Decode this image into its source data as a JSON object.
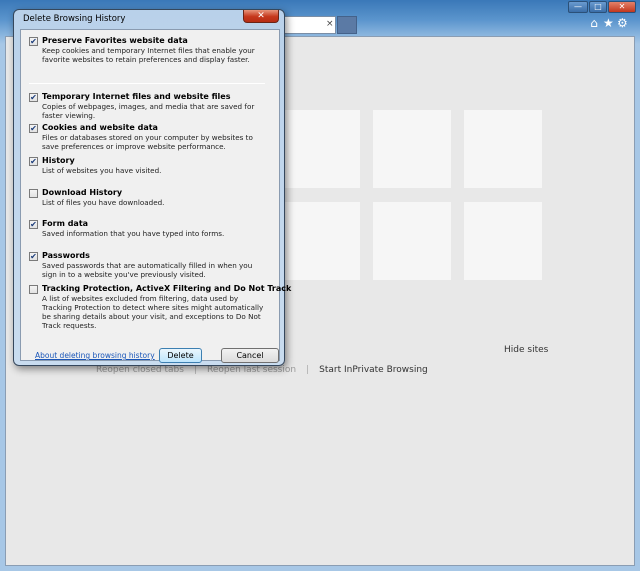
{
  "window": {
    "minimize_glyph": "—",
    "maximize_glyph": "□",
    "close_glyph": "✕"
  },
  "toolbar": {
    "address_close_glyph": "×",
    "icons": [
      "home-icon",
      "favorites-star-icon",
      "gear-icon"
    ],
    "home_glyph": "⌂",
    "star_glyph": "★",
    "gear_glyph": "⚙"
  },
  "new_tab_page": {
    "hide_sites_label": "Hide sites",
    "links": {
      "reopen_closed_tabs": "Reopen closed tabs",
      "reopen_last_session": "Reopen last session",
      "start_inprivate": "Start InPrivate Browsing"
    }
  },
  "dialog": {
    "title": "Delete Browsing History",
    "close_glyph": "✕",
    "options": [
      {
        "title": "Preserve Favorites website data",
        "checked": true,
        "description": "Keep cookies and temporary Internet files that enable your favorite websites to retain preferences and display faster."
      },
      {
        "title": "Temporary Internet files and website files",
        "checked": true,
        "description": "Copies of webpages, images, and media that are saved for faster viewing."
      },
      {
        "title": "Cookies and website data",
        "checked": true,
        "description": "Files or databases stored on your computer by websites to save preferences or improve website performance."
      },
      {
        "title": "History",
        "checked": true,
        "description": "List of websites you have visited."
      },
      {
        "title": "Download History",
        "checked": false,
        "description": "List of files you have downloaded."
      },
      {
        "title": "Form data",
        "checked": true,
        "description": "Saved information that you have typed into forms."
      },
      {
        "title": "Passwords",
        "checked": true,
        "description": "Saved passwords that are automatically filled in when you sign in to a website you've previously visited."
      },
      {
        "title": "Tracking Protection, ActiveX Filtering and Do Not Track",
        "checked": false,
        "description": "A list of websites excluded from filtering, data used by Tracking Protection to detect where sites might automatically be sharing details about your visit, and exceptions to Do Not Track requests."
      }
    ],
    "about_link": "About deleting browsing history",
    "delete_label": "Delete",
    "cancel_label": "Cancel"
  },
  "colors": {
    "titlebar": "#3a78b8",
    "dialog_frame": "#c9dcef",
    "link": "#1a56b8",
    "close_button": "#c5371c"
  }
}
